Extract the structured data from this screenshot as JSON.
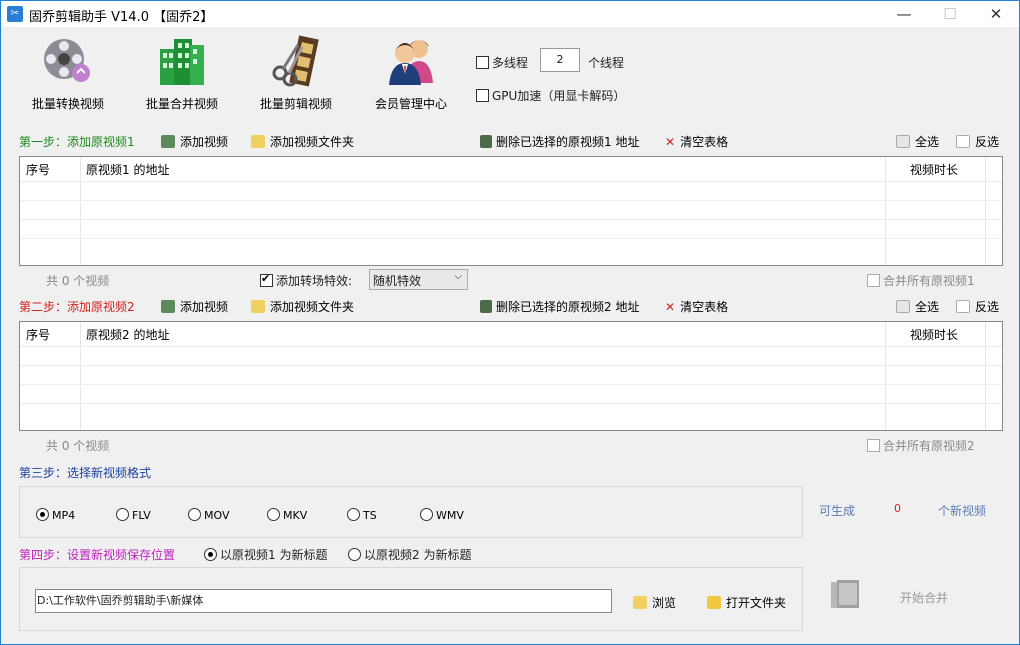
{
  "window": {
    "title": "固乔剪辑助手 V14.0  【固乔2】",
    "minimize": "—",
    "maximize": "☐",
    "close": "✕"
  },
  "toolbar": {
    "items": [
      {
        "label": "批量转换视频",
        "icon": "film-reel-icon"
      },
      {
        "label": "批量合并视频",
        "icon": "building-grid-icon"
      },
      {
        "label": "批量剪辑视频",
        "icon": "film-scissors-icon"
      },
      {
        "label": "会员管理中心",
        "icon": "members-icon"
      }
    ],
    "multithread_label": "多线程",
    "thread_count": "2",
    "thread_unit": "个线程",
    "gpu_label": "GPU加速（用显卡解码）"
  },
  "step1": {
    "title": "第一步：添加原视频1",
    "add_video": "添加视频",
    "add_folder": "添加视频文件夹",
    "delete_selected": "删除已选择的原视频1 地址",
    "clear_table": "清空表格",
    "select_all": "全选",
    "invert": "反选",
    "columns": [
      "序号",
      "原视频1 的地址",
      "视频时长"
    ],
    "count_text": "共 0 个视频",
    "transition_label": "添加转场特效:",
    "transition_value": "随机特效",
    "merge_all": "合并所有原视频1"
  },
  "step2": {
    "title": "第二步：添加原视频2",
    "add_video": "添加视频",
    "add_folder": "添加视频文件夹",
    "delete_selected": "删除已选择的原视频2 地址",
    "clear_table": "清空表格",
    "select_all": "全选",
    "invert": "反选",
    "columns": [
      "序号",
      "原视频2 的地址",
      "视频时长"
    ],
    "count_text": "共 0 个视频",
    "merge_all": "合并所有原视频2"
  },
  "step3": {
    "title": "第三步：选择新视频格式",
    "formats": [
      "MP4",
      "FLV",
      "MOV",
      "MKV",
      "TS",
      "WMV"
    ],
    "selected": "MP4",
    "can_generate": "可生成",
    "count": "0",
    "unit": "个新视频"
  },
  "step4": {
    "title": "第四步：设置新视频保存位置",
    "option1": "以原视频1 为新标题",
    "option2": "以原视频2 为新标题",
    "path": "D:\\工作软件\\固乔剪辑助手\\新媒体",
    "browse": "浏览",
    "open_folder": "打开文件夹",
    "start": "开始合并"
  },
  "colors": {
    "step1": "#1a8a1a",
    "step2": "#d42020",
    "step3": "#1a3fa0",
    "step4": "#c020c0",
    "count_red": "#d42020",
    "generate_blue": "#5b7bb8"
  }
}
